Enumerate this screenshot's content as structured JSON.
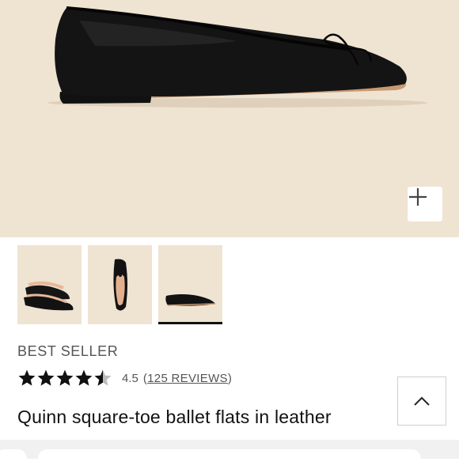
{
  "gallery": {
    "zoom_icon": "plus-icon",
    "thumbnails": [
      {
        "name": "thumbnail-pair-view",
        "active": false
      },
      {
        "name": "thumbnail-top-view",
        "active": false
      },
      {
        "name": "thumbnail-side-view",
        "active": true
      }
    ]
  },
  "product": {
    "badge": "BEST SELLER",
    "rating": 4.5,
    "rating_text": "4.5",
    "reviews_open": "(",
    "reviews_label": "125 REVIEWS",
    "reviews_close": ")",
    "title": "Quinn square-toe ballet flats in leather"
  },
  "scroll_top": {
    "icon": "chevron-up-icon"
  },
  "colors": {
    "hero_background": "#efe3d2",
    "shoe": "#141414",
    "star": "#111111",
    "text_muted": "#555555"
  }
}
